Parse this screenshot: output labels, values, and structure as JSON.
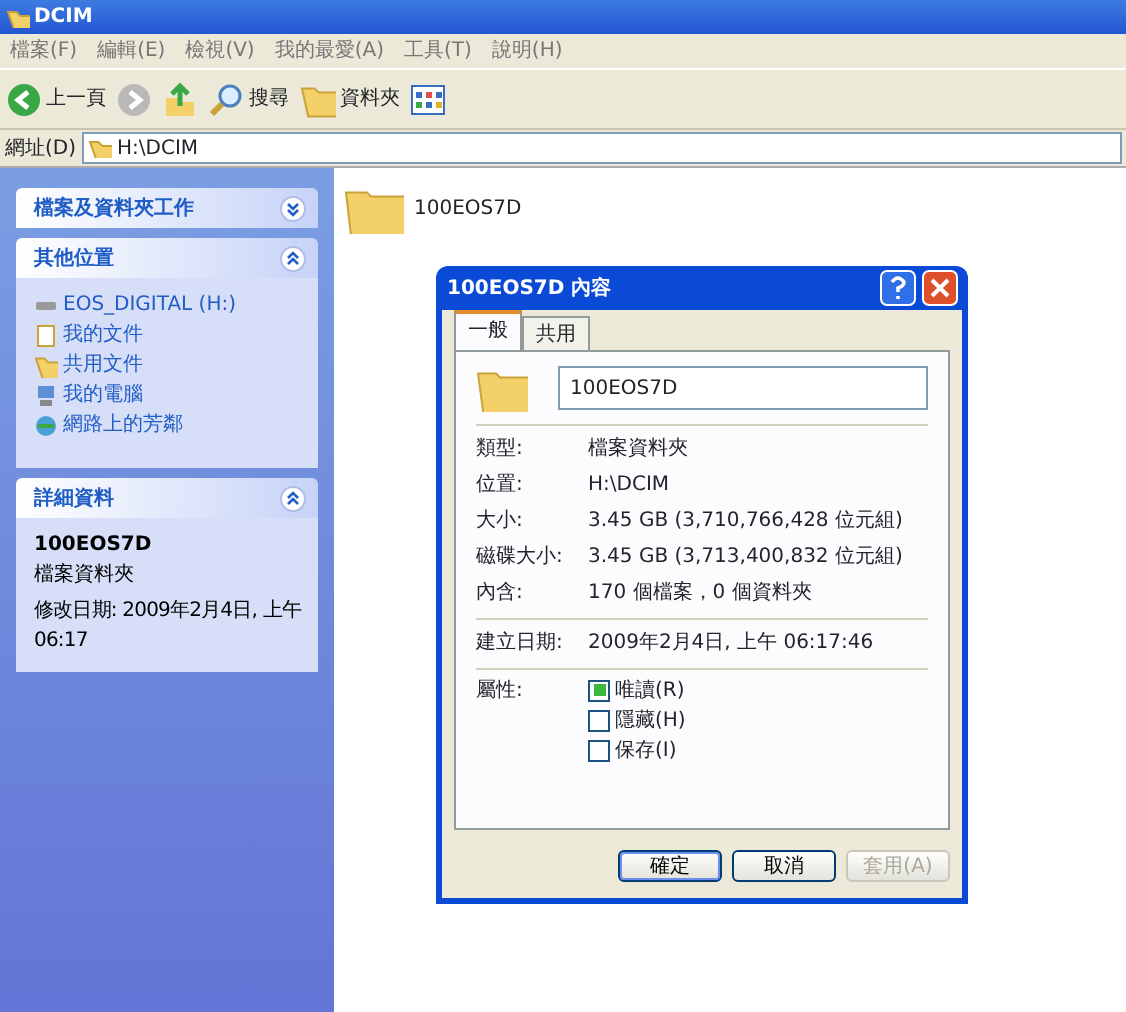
{
  "window": {
    "title": "DCIM"
  },
  "menu": [
    "檔案(F)",
    "編輯(E)",
    "檢視(V)",
    "我的最愛(A)",
    "工具(T)",
    "說明(H)"
  ],
  "toolbar": [
    {
      "kind": "back",
      "label": "上一頁"
    },
    {
      "kind": "forward"
    },
    {
      "kind": "up"
    },
    {
      "kind": "search",
      "label": "搜尋"
    },
    {
      "kind": "folders",
      "label": "資料夾"
    },
    {
      "kind": "views"
    }
  ],
  "address": {
    "label": "網址(D)",
    "value": "H:\\DCIM"
  },
  "sidebar": [
    {
      "title": "檔案及資料夾工作",
      "expanded": false
    },
    {
      "title": "其他位置",
      "expanded": true,
      "items": [
        {
          "kind": "drive",
          "label": "EOS_DIGITAL (H:)"
        },
        {
          "kind": "documents",
          "label": "我的文件"
        },
        {
          "kind": "shared",
          "label": "共用文件"
        },
        {
          "kind": "computer",
          "label": "我的電腦"
        },
        {
          "kind": "network",
          "label": "網路上的芳鄰"
        }
      ]
    },
    {
      "title": "詳細資料",
      "expanded": true,
      "details": {
        "name": "100EOS7D",
        "type": "檔案資料夾",
        "modified": "修改日期: 2009年2月4日, 上午 06:17"
      }
    }
  ],
  "folders": [
    {
      "name": "100EOS7D"
    }
  ],
  "dialog": {
    "title": "100EOS7D 內容",
    "tabs": [
      {
        "label": "一般",
        "selected": true
      },
      {
        "label": "共用",
        "selected": false
      }
    ],
    "name": "100EOS7D",
    "sections": [
      [
        {
          "label": "類型:",
          "value": "檔案資料夾"
        },
        {
          "label": "位置:",
          "value": "H:\\DCIM"
        },
        {
          "label": "大小:",
          "value": "3.45 GB (3,710,766,428 位元組)"
        },
        {
          "label": "磁碟大小:",
          "value": "3.45 GB (3,713,400,832 位元組)"
        },
        {
          "label": "內含:",
          "value": "170 個檔案，0 個資料夾"
        }
      ],
      [
        {
          "label": "建立日期:",
          "value": "2009年2月4日, 上午 06:17:46"
        }
      ]
    ],
    "attributes_label": "屬性:",
    "attributes": [
      {
        "label": "唯讀(R)",
        "checked": true,
        "mixed": true
      },
      {
        "label": "隱藏(H)",
        "checked": false,
        "mixed": false
      },
      {
        "label": "保存(I)",
        "checked": false,
        "mixed": false
      }
    ],
    "buttons": [
      {
        "label": "確定",
        "disabled": false
      },
      {
        "label": "取消",
        "disabled": false
      },
      {
        "label": "套用(A)",
        "disabled": true
      }
    ]
  }
}
